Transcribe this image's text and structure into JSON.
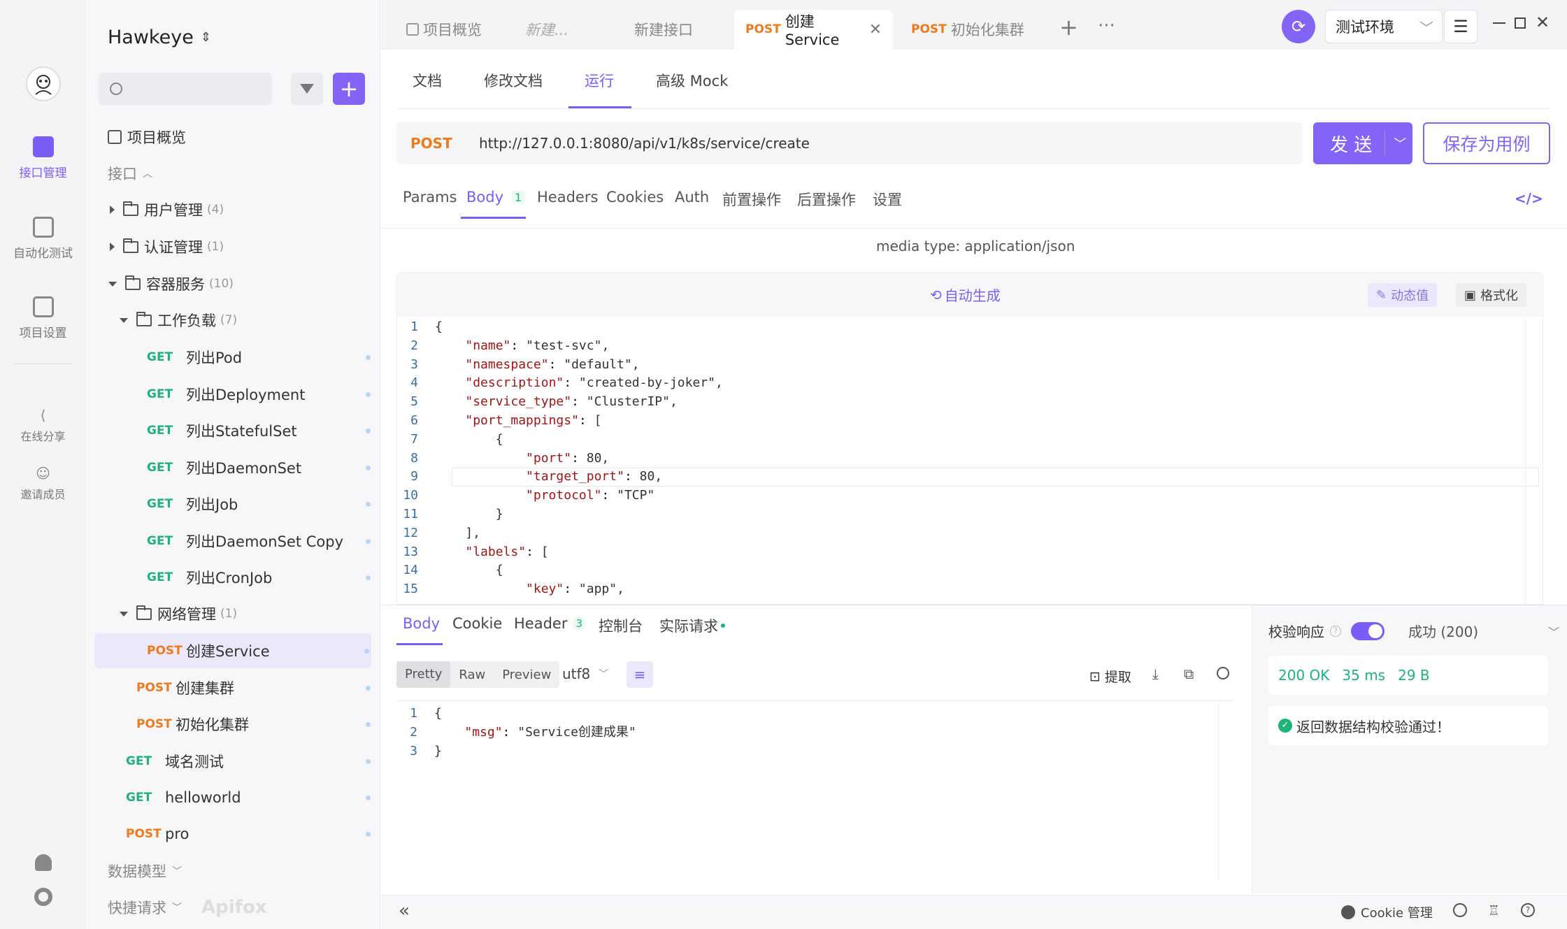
{
  "app": {
    "project_name": "Hawkeye",
    "brand": "Apifox",
    "accent": "#7c5cf6"
  },
  "rail": {
    "items": [
      {
        "label": "接口管理"
      },
      {
        "label": "自动化测试"
      },
      {
        "label": "项目设置"
      },
      {
        "label": "在线分享"
      },
      {
        "label": "邀请成员"
      }
    ]
  },
  "sidebar": {
    "overview": "项目概览",
    "section_interfaces": "接口",
    "section_data_models": "数据模型",
    "section_quick_requests": "快捷请求",
    "tree": [
      {
        "type": "folder",
        "label": "用户管理",
        "count": "(4)"
      },
      {
        "type": "folder",
        "label": "认证管理",
        "count": "(1)"
      },
      {
        "type": "folder",
        "label": "容器服务",
        "count": "(10)"
      },
      {
        "type": "folder",
        "label": "工作负载",
        "count": "(7)"
      },
      {
        "type": "api",
        "method": "GET",
        "label": "列出Pod"
      },
      {
        "type": "api",
        "method": "GET",
        "label": "列出Deployment"
      },
      {
        "type": "api",
        "method": "GET",
        "label": "列出StatefulSet"
      },
      {
        "type": "api",
        "method": "GET",
        "label": "列出DaemonSet"
      },
      {
        "type": "api",
        "method": "GET",
        "label": "列出Job"
      },
      {
        "type": "api",
        "method": "GET",
        "label": "列出DaemonSet Copy"
      },
      {
        "type": "api",
        "method": "GET",
        "label": "列出CronJob"
      },
      {
        "type": "folder",
        "label": "网络管理",
        "count": "(1)"
      },
      {
        "type": "api",
        "method": "POST",
        "label": "创建Service"
      },
      {
        "type": "api",
        "method": "POST",
        "label": "创建集群"
      },
      {
        "type": "api",
        "method": "POST",
        "label": "初始化集群"
      },
      {
        "type": "api",
        "method": "GET",
        "label": "域名测试"
      },
      {
        "type": "api",
        "method": "GET",
        "label": "helloworld"
      },
      {
        "type": "api",
        "method": "POST",
        "label": "pro"
      }
    ]
  },
  "tabs": [
    {
      "label": "项目概览"
    },
    {
      "label": "新建..."
    },
    {
      "label": "新建接口"
    },
    {
      "method": "POST",
      "label": "创建Service"
    },
    {
      "method": "POST",
      "label": "初始化集群"
    }
  ],
  "env": {
    "label": "测试环境"
  },
  "subtabs": [
    "文档",
    "修改文档",
    "运行",
    "高级 Mock"
  ],
  "request": {
    "method": "POST",
    "url": "http://127.0.0.1:8080/api/v1/k8s/service/create",
    "send_label": "发 送",
    "save_label": "保存为用例"
  },
  "param_tabs": [
    {
      "label": "Params"
    },
    {
      "label": "Body",
      "badge": "1"
    },
    {
      "label": "Headers"
    },
    {
      "label": "Cookies"
    },
    {
      "label": "Auth"
    },
    {
      "label": "前置操作"
    },
    {
      "label": "后置操作"
    },
    {
      "label": "设置"
    }
  ],
  "body": {
    "media_type": "media type: application/json",
    "auto_generate": "自动生成",
    "dynamic_value": "动态值",
    "format": "格式化",
    "lines": [
      "{",
      "    \"name\": \"test-svc\",",
      "    \"namespace\": \"default\",",
      "    \"description\": \"created-by-joker\",",
      "    \"service_type\": \"ClusterIP\",",
      "    \"port_mappings\": [",
      "        {",
      "            \"port\": 80,",
      "            \"target_port\": 80,",
      "            \"protocol\": \"TCP\"",
      "        }",
      "    ],",
      "    \"labels\": [",
      "        {",
      "            \"key\": \"app\","
    ]
  },
  "response": {
    "tabs": [
      {
        "label": "Body"
      },
      {
        "label": "Cookie"
      },
      {
        "label": "Header",
        "badge": "3"
      },
      {
        "label": "控制台"
      },
      {
        "label": "实际请求"
      }
    ],
    "view_modes": [
      "Pretty",
      "Raw",
      "Preview"
    ],
    "encoding": "utf8",
    "extract": "提取",
    "lines": [
      "{",
      "    \"msg\": \"Service创建成果\"",
      "}"
    ],
    "validate_label": "校验响应",
    "validate_result": "成功 (200)",
    "status": "200 OK",
    "time": "35 ms",
    "size": "29 B",
    "validation_msg": "返回数据结构校验通过！"
  },
  "footer": {
    "cookie_manage": "Cookie 管理"
  }
}
